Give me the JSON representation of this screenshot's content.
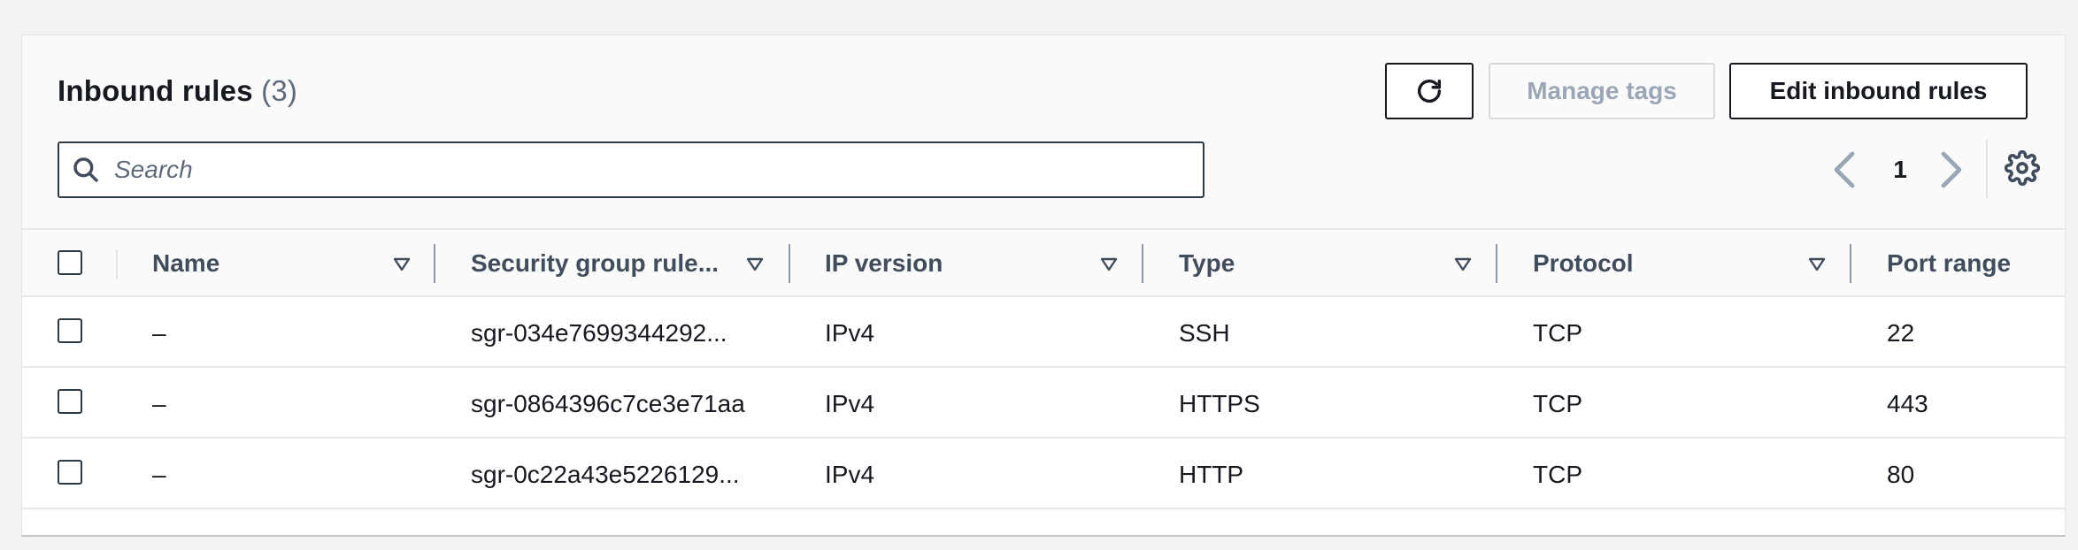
{
  "header": {
    "title": "Inbound rules",
    "count": "(3)",
    "manage_tags_label": "Manage tags",
    "edit_rules_label": "Edit inbound rules",
    "search_placeholder": "Search"
  },
  "pagination": {
    "current_page": "1"
  },
  "columns": [
    {
      "label": "Name"
    },
    {
      "label": "Security group rule..."
    },
    {
      "label": "IP version"
    },
    {
      "label": "Type"
    },
    {
      "label": "Protocol"
    },
    {
      "label": "Port range"
    }
  ],
  "rows": [
    {
      "name": "–",
      "rule_id": "sgr-034e7699344292...",
      "ip_version": "IPv4",
      "type": "SSH",
      "protocol": "TCP",
      "port_range": "22"
    },
    {
      "name": "–",
      "rule_id": "sgr-0864396c7ce3e71aa",
      "ip_version": "IPv4",
      "type": "HTTPS",
      "protocol": "TCP",
      "port_range": "443"
    },
    {
      "name": "–",
      "rule_id": "sgr-0c22a43e5226129...",
      "ip_version": "IPv4",
      "type": "HTTP",
      "protocol": "TCP",
      "port_range": "80"
    }
  ],
  "icons": {
    "refresh": "refresh-icon",
    "search": "search-icon",
    "prev": "chevron-left-icon",
    "next": "chevron-right-icon",
    "settings": "gear-icon",
    "sort": "sort-caret-down-icon"
  },
  "colors": {
    "text": "#16191f",
    "muted": "#5f6b7a",
    "disabled": "#9ba7b6",
    "border": "#e6e8ea"
  }
}
